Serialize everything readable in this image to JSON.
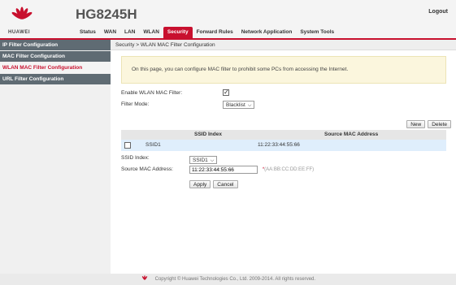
{
  "header": {
    "brand": "HUAWEI",
    "model": "HG8245H",
    "logout": "Logout",
    "brand_color": "#c8102e"
  },
  "nav": {
    "items": [
      "Status",
      "WAN",
      "LAN",
      "WLAN",
      "Security",
      "Forward Rules",
      "Network Application",
      "System Tools"
    ],
    "active": "Security"
  },
  "sidebar": {
    "items": [
      "IP Filter Configuration",
      "MAC Filter Configuration",
      "WLAN MAC Filter Configuration",
      "URL Filter Configuration"
    ],
    "active": "WLAN MAC Filter Configuration"
  },
  "breadcrumb": "Security > WLAN MAC Filter Configuration",
  "notice": "On this page, you can configure MAC filter to prohibit some PCs from accessing the Internet.",
  "settings": {
    "enable_label": "Enable WLAN MAC Filter:",
    "enable_checked": true,
    "mode_label": "Filter Mode:",
    "mode_value": "Blacklist"
  },
  "toolbar": {
    "new_label": "New",
    "delete_label": "Delete"
  },
  "table": {
    "columns": [
      "SSID Index",
      "Source MAC Address"
    ],
    "rows": [
      {
        "ssid": "SSID1",
        "mac": "11:22:33:44:55:66"
      }
    ]
  },
  "edit": {
    "ssid_label": "SSID Index:",
    "ssid_value": "SSID1",
    "mac_label": "Source MAC Address:",
    "mac_value": "11:22:33:44:55:66",
    "required_mark": "*",
    "mac_hint": "(AA:BB:CC:DD:EE:FF)",
    "apply_label": "Apply",
    "cancel_label": "Cancel"
  },
  "footer": {
    "copyright": "Copyright © Huawei Technologies Co., Ltd. 2009-2014. All rights reserved."
  }
}
